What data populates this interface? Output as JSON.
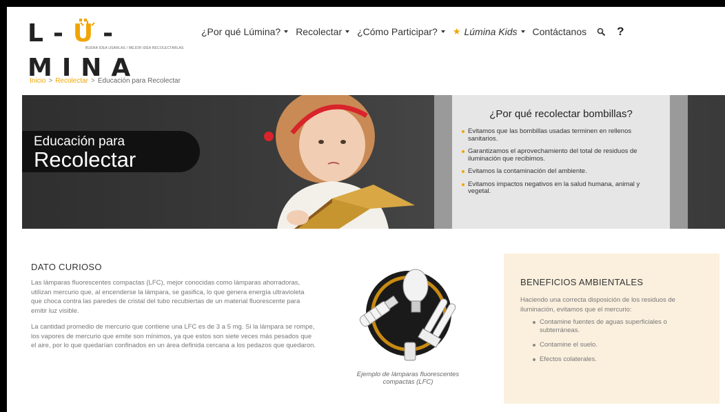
{
  "logo": {
    "text_pre": "L-",
    "text_u": "Ü",
    "text_post": "-MINA",
    "tagline": "BUENA IDEA USARLAS / MEJOR IDEA RECOLECTARLAS"
  },
  "nav": {
    "items": [
      {
        "label": "¿Por qué Lúmina?"
      },
      {
        "label": "Recolectar"
      },
      {
        "label": "¿Cómo Participar?"
      },
      {
        "label": "Lúmina Kids"
      },
      {
        "label": "Contáctanos"
      }
    ],
    "help_label": "?"
  },
  "breadcrumb": {
    "home": "Inicio",
    "parent": "Recolectar",
    "current": "Educación para Recolectar",
    "separator": ">"
  },
  "hero": {
    "title_line1": "Educación para",
    "title_line2": "Recolectar",
    "panel_title": "¿Por qué recolectar bombillas?",
    "panel_items": [
      "Evitamos que las bombillas usadas terminen en rellenos sanitarios.",
      "Garantizamos el aprovechamiento del total de residuos de iluminación que recibimos.",
      "Evitamos la contaminación del ambiente.",
      "Evitamos impactos negativos en la salud humana, animal y vegetal."
    ]
  },
  "dato": {
    "heading": "DATO CURIOSO",
    "p1": "Las lámparas fluorescentes compactas (LFC), mejor conocidas como lámparas ahorradoras, utilizan mercurio que, al encenderse la lámpara, se gasifica, lo que genera energía ultravioleta que choca contra las paredes de cristal del tubo recubiertas de un material fluorescente para emitir luz visible.",
    "p2": "La cantidad promedio de mercurio que contiene una LFC es de 3 a 5 mg. Si la lámpara se rompe, los vapores de mercurio que emite son mínimos, ya que estos son siete veces más pesados que el aire, por lo que quedarían confinados en un área definida cercana a los pedazos que quedaron."
  },
  "lamp": {
    "caption": "Ejemplo de lámparas fluorescentes compactas (LFC)"
  },
  "beneficios": {
    "heading": "BENEFICIOS AMBIENTALES",
    "intro": "Haciendo una correcta disposición de los residuos de iluminación, evitamos que el mercurio:",
    "items": [
      "Contamine fuentes de aguas superficiales o subterráneas.",
      "Contamine el suelo.",
      "Efectos colaterales."
    ]
  },
  "colors": {
    "accent": "#f0a500",
    "hero_dark": "#111111",
    "panel_bg": "#e6e6e6",
    "benefits_bg": "#fbf0de"
  }
}
